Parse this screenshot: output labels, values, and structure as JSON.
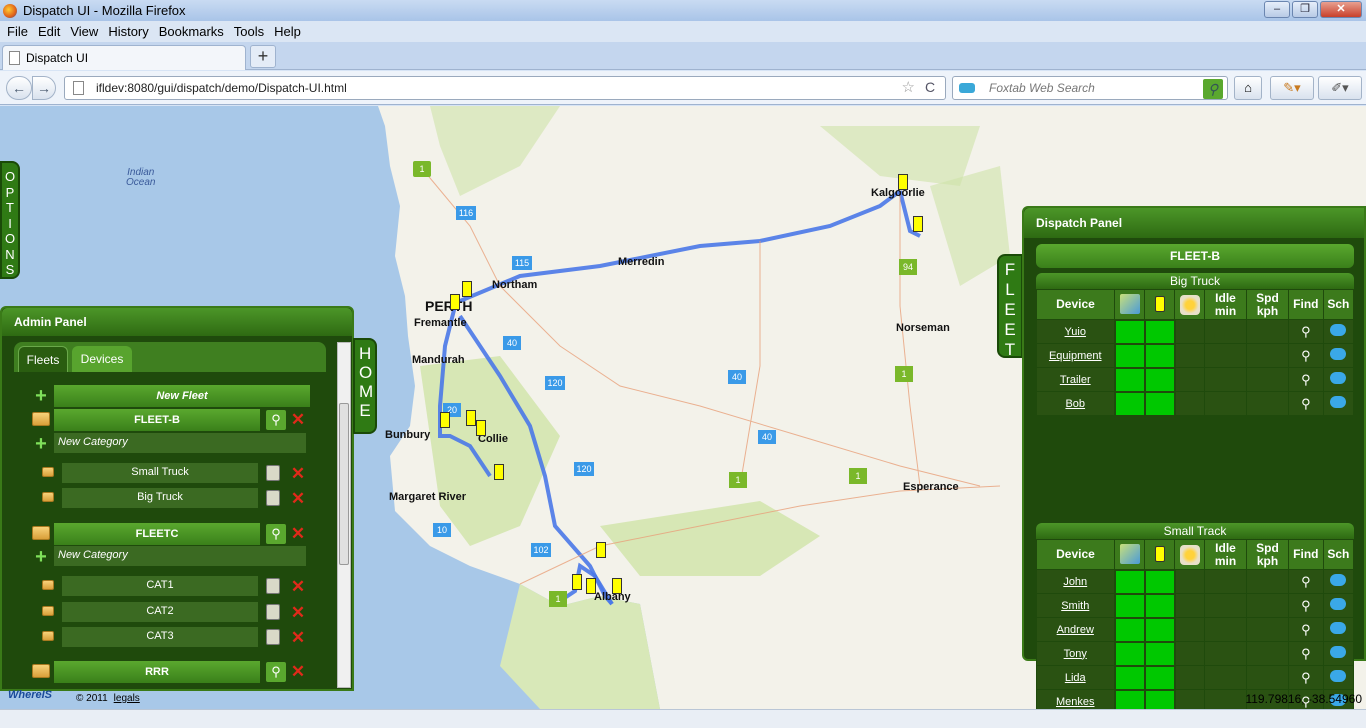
{
  "window": {
    "title": "Dispatch UI - Mozilla Firefox",
    "min": "–",
    "max": "❐",
    "close": "✕"
  },
  "menu": [
    "File",
    "Edit",
    "View",
    "History",
    "Bookmarks",
    "Tools",
    "Help"
  ],
  "tab": {
    "label": "Dispatch UI",
    "new_tab": "+"
  },
  "nav": {
    "back": "←",
    "forward": "→",
    "url": "ifldev:8080/gui/dispatch/demo/Dispatch-UI.html",
    "search_placeholder": "Foxtab Web Search",
    "reload": "C",
    "star": "☆",
    "home": "⌂",
    "search_icon": "⚲"
  },
  "map": {
    "places": [
      "PERTH",
      "Northam",
      "Merredin",
      "Kalgoorlie",
      "Fremantle",
      "Mandurah",
      "Norseman",
      "Bunbury",
      "Collie",
      "Margaret River",
      "Esperance",
      "Albany"
    ],
    "ocean_label": [
      "Indian",
      "Ocean"
    ],
    "road_shields": [
      "1",
      "116",
      "115",
      "94",
      "40",
      "120",
      "1",
      "40",
      "20",
      "120",
      "1",
      "1",
      "102",
      "10",
      "1",
      "40"
    ],
    "coordinates": "119.79816, -38.54960",
    "attribution": "WhereIS",
    "copyright": "© 2011",
    "legals": "legals"
  },
  "side_tabs": {
    "options": "OPTIONS",
    "home": "HOME",
    "fleet": "FLEET"
  },
  "admin_panel": {
    "title": "Admin Panel",
    "tabs": [
      "Fleets",
      "Devices"
    ],
    "new_fleet": "New Fleet",
    "new_category": "New Category",
    "fleets": [
      {
        "name": "FLEET-B",
        "categories": [
          "Small Truck",
          "Big Truck"
        ]
      },
      {
        "name": "FLEETC",
        "categories": [
          "CAT1",
          "CAT2",
          "CAT3"
        ]
      },
      {
        "name": "RRR",
        "categories": []
      }
    ]
  },
  "dispatch_panel": {
    "title": "Dispatch Panel",
    "fleet": "FLEET-B",
    "columns": [
      "Device",
      "Idle min",
      "Spd kph",
      "Find",
      "Sch"
    ],
    "idle_header": [
      "Idle",
      "min"
    ],
    "spd_header": [
      "Spd",
      "kph"
    ],
    "groups": [
      {
        "name": "Big Truck",
        "devices": [
          "Yuio",
          "Equipment",
          "Trailer",
          "Bob"
        ]
      },
      {
        "name": "Small Track",
        "devices": [
          "John",
          "Smith",
          "Andrew",
          "Tony",
          "Lida",
          "Menkes"
        ]
      }
    ]
  }
}
